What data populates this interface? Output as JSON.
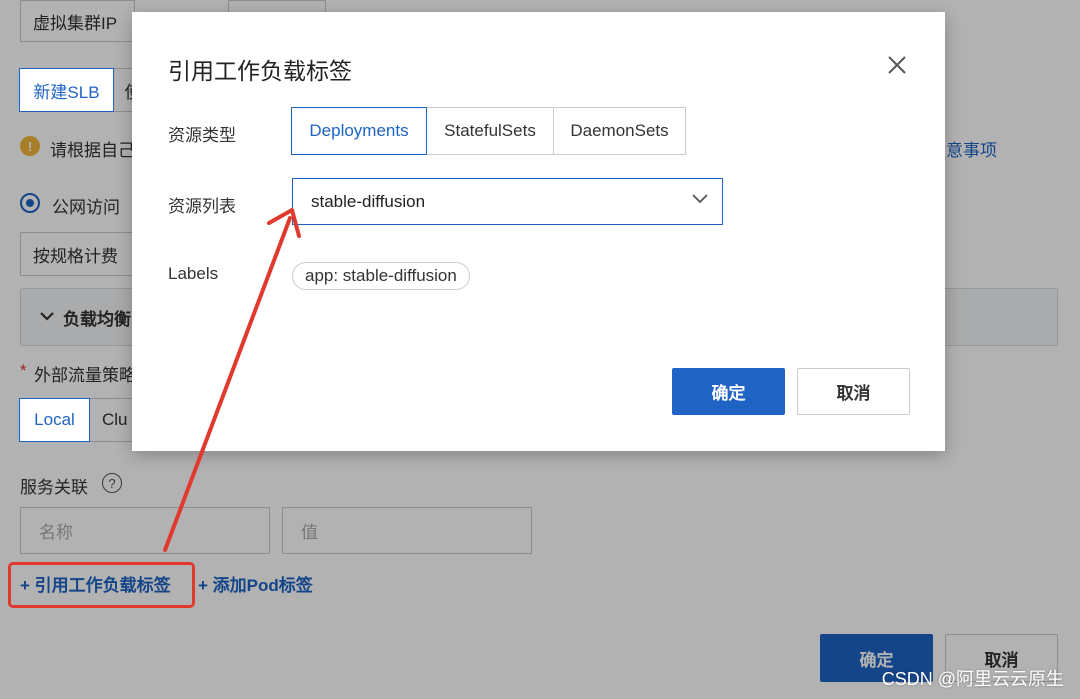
{
  "background_form": {
    "virtual_cluster_ip": "虚拟集群IP",
    "new_slb_button": "新建SLB",
    "new_slb_next_partial": "使",
    "warning_text": "请根据自己",
    "warning_link": "意事项",
    "public_access_label": "公网访问",
    "billing_select": "按规格计费",
    "load_balancer_section": "负载均衡",
    "external_traffic_policy_label": "外部流量策略",
    "required_mark": "*",
    "policy_options": [
      "Local",
      "Clu"
    ],
    "service_association_label": "服务关联",
    "help_symbol": "?",
    "name_placeholder": "名称",
    "value_placeholder": "值",
    "ref_workload_labels_link": "+ 引用工作负载标签",
    "add_pod_label_link": "+ 添加Pod标签",
    "confirm_button": "确定",
    "cancel_button": "取消"
  },
  "modal": {
    "title": "引用工作负载标签",
    "resource_type_label": "资源类型",
    "resource_types": [
      "Deployments",
      "StatefulSets",
      "DaemonSets"
    ],
    "resource_type_selected": "Deployments",
    "resource_list_label": "资源列表",
    "resource_list_value": "stable-diffusion",
    "labels_label": "Labels",
    "labels": [
      "app: stable-diffusion"
    ],
    "confirm_button": "确定",
    "cancel_button": "取消"
  },
  "annotation": {
    "color": "#e03a2e"
  },
  "colors": {
    "primary": "#1f63c4",
    "warning": "#f2b53a"
  },
  "watermark": "CSDN @阿里云云原生"
}
